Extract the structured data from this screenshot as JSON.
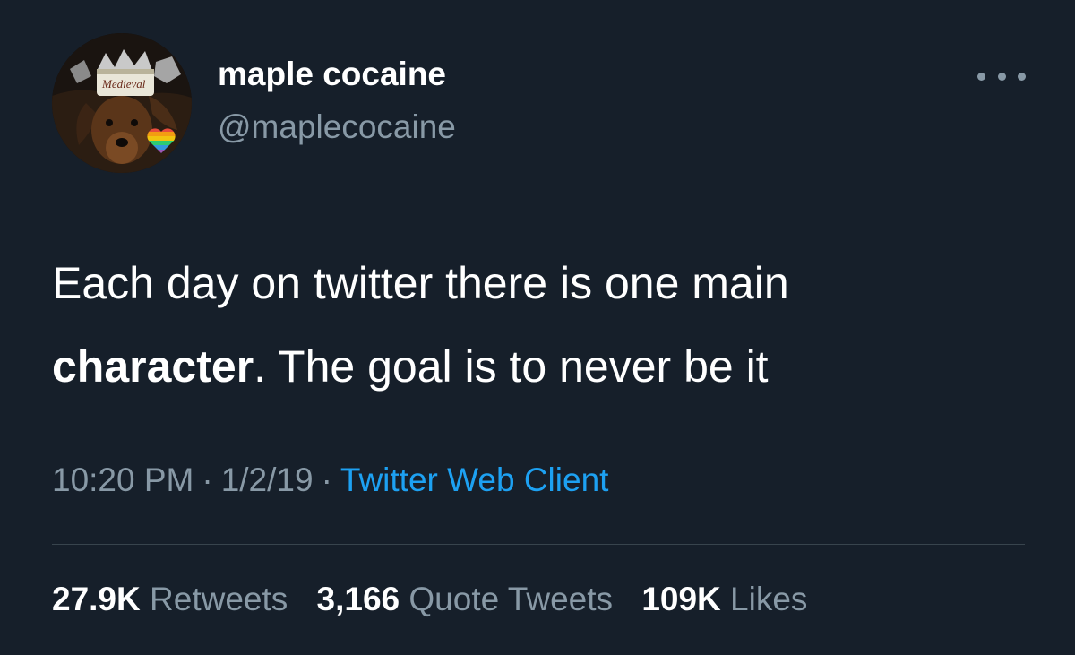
{
  "user": {
    "display_name": "maple cocaine",
    "handle": "@maplecocaine",
    "avatar_badge_text": "Medieval",
    "avatar_badge_icon": "rainbow-heart-icon"
  },
  "tweet": {
    "line1": "Each day on twitter there is one main",
    "bold_word": "character",
    "line2_rest": ". The goal is to never be it"
  },
  "meta": {
    "time": "10:20 PM",
    "separator": "·",
    "date": "1/2/19",
    "client": "Twitter Web Client"
  },
  "stats": {
    "retweets_count": "27.9K",
    "retweets_label": "Retweets",
    "quotes_count": "3,166",
    "quotes_label": "Quote Tweets",
    "likes_count": "109K",
    "likes_label": "Likes"
  },
  "colors": {
    "background": "#161f2a",
    "secondary_text": "#8899a6",
    "link": "#1da1f2",
    "divider": "#38444d"
  }
}
